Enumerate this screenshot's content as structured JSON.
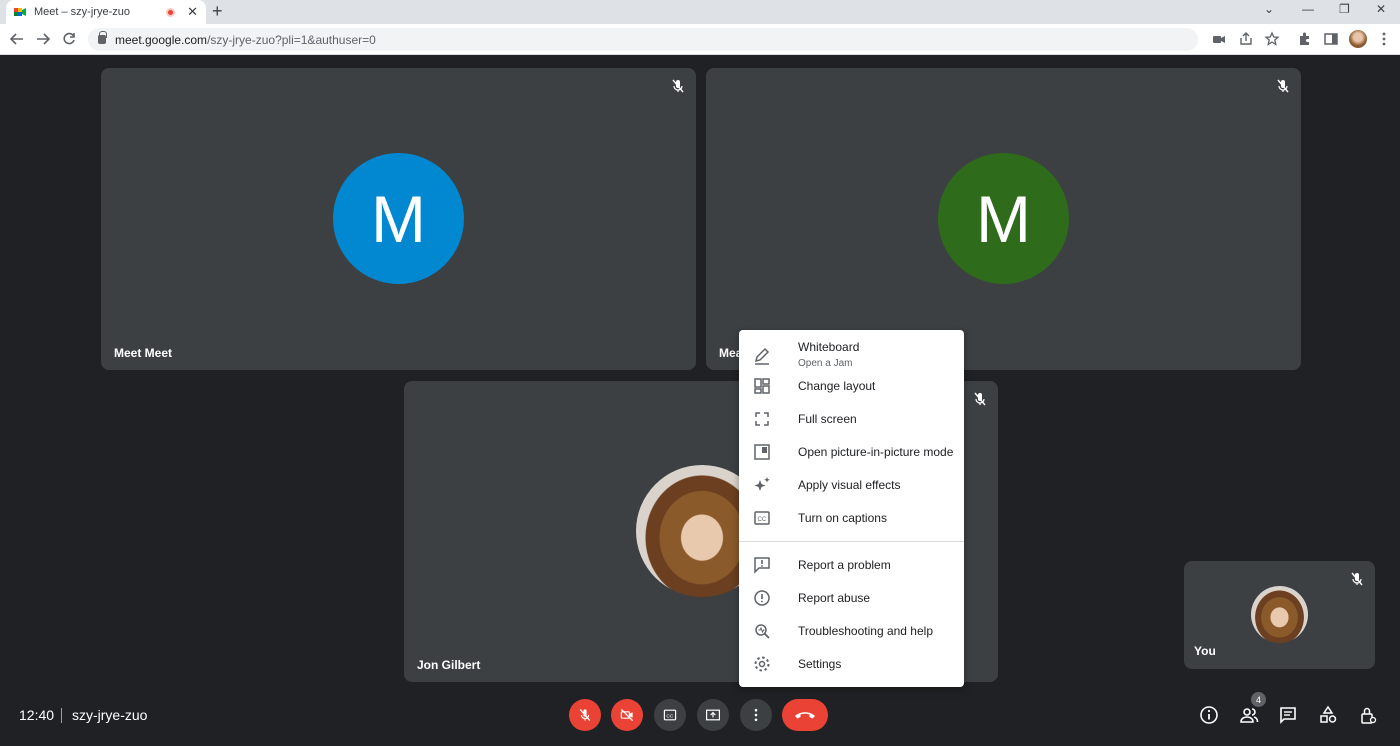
{
  "browser": {
    "tab_title": "Meet – szy-jrye-zuo",
    "tab_close": "✕",
    "new_tab": "+",
    "url_host": "meet.google.com",
    "url_path": "/szy-jrye-zuo?pli=1&authuser=0",
    "window_controls": {
      "dropdown": "⌄",
      "minimize": "—",
      "restore": "❐",
      "close": "✕"
    }
  },
  "tiles": [
    {
      "name": "Meet Meet",
      "initial": "M",
      "avatar_color": "#0288d1"
    },
    {
      "name": "Mea",
      "initial": "M",
      "avatar_color": "#2e6b1b"
    },
    {
      "name": "Jon Gilbert"
    },
    {
      "name": "You"
    }
  ],
  "menu": {
    "items": [
      {
        "label": "Whiteboard",
        "sub": "Open a Jam",
        "icon": "pencil-icon"
      },
      {
        "label": "Change layout",
        "icon": "layout-icon"
      },
      {
        "label": "Full screen",
        "icon": "fullscreen-icon"
      },
      {
        "label": "Open picture-in-picture mode",
        "icon": "pip-icon"
      },
      {
        "label": "Apply visual effects",
        "icon": "sparkle-icon"
      },
      {
        "label": "Turn on captions",
        "icon": "captions-icon"
      },
      {
        "label": "Report a problem",
        "icon": "report-problem-icon"
      },
      {
        "label": "Report abuse",
        "icon": "report-abuse-icon"
      },
      {
        "label": "Troubleshooting and help",
        "icon": "troubleshoot-icon"
      },
      {
        "label": "Settings",
        "icon": "settings-icon"
      }
    ]
  },
  "bottom_bar": {
    "time": "12:40",
    "meeting_code": "szy-jrye-zuo",
    "people_count": "4"
  },
  "colors": {
    "accent_red": "#ea4335",
    "tile_bg": "#3c4043",
    "page_bg": "#202124"
  }
}
